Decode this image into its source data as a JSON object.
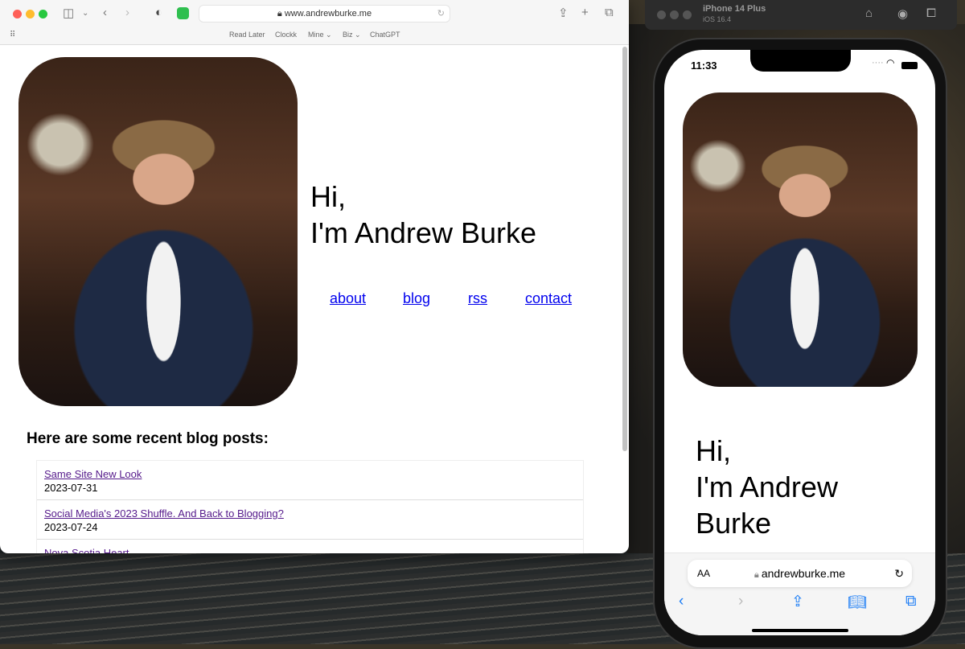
{
  "safari": {
    "url": "www.andrewburke.me",
    "favorites": [
      "Read Later",
      "Clockk",
      "Mine ⌄",
      "Biz ⌄",
      "ChatGPT"
    ],
    "page": {
      "greeting": "Hi,",
      "name": "I'm Andrew Burke",
      "nav": [
        "about",
        "blog",
        "rss",
        "contact"
      ],
      "posts_heading": "Here are some recent blog posts:",
      "posts": [
        {
          "title": "Same Site New Look",
          "date": "2023-07-31"
        },
        {
          "title": "Social Media's 2023 Shuffle. And Back to Blogging?",
          "date": "2023-07-24"
        },
        {
          "title": "Nova Scotia Heart",
          "date": ""
        }
      ]
    }
  },
  "simulator": {
    "device": "iPhone 14 Plus",
    "os": "iOS 16.4",
    "time": "11:33",
    "page": {
      "greeting": "Hi,",
      "name_line1": "I'm Andrew",
      "name_line2": "Burke"
    },
    "url": "andrewburke.me",
    "text_size_label": "AA"
  },
  "colors": {
    "link": "#0000ee",
    "visited": "#551a8b",
    "ios_accent": "#1a7cf5"
  }
}
